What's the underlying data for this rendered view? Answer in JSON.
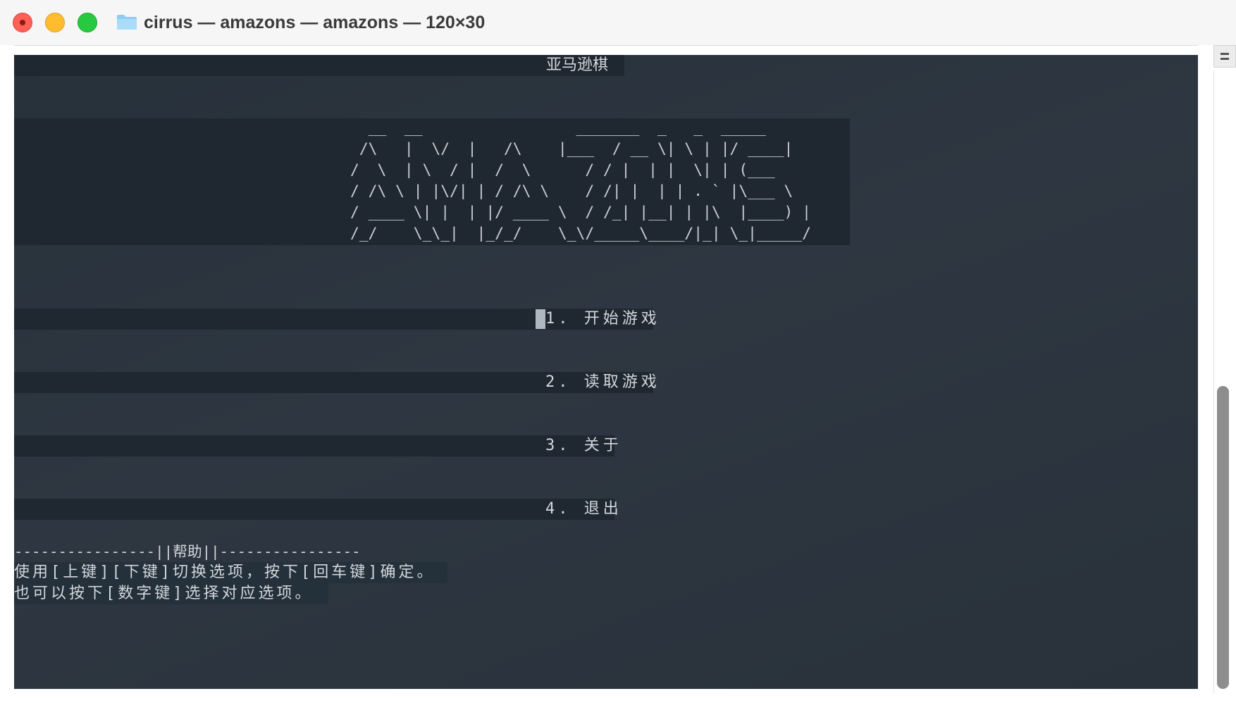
{
  "window": {
    "title": "cirrus — amazons — amazons — 120×30",
    "folder_icon": "folder-icon",
    "controls": [
      "close",
      "minimize",
      "maximize"
    ],
    "colors": {
      "close": "#fe5f57",
      "minimize": "#febc2e",
      "maximize": "#28c840"
    }
  },
  "terminal": {
    "header_title": "亚马逊棋",
    "ascii_logo": "  __  __                 _______  _   _  _____\n /\\   |  \\/  |   /\\    |___  / __ \\| \\ | |/ ____|\n/  \\  | \\  / |  /  \\      / / |  | |  \\| | (___\n/ /\\ \\ | |\\/| | / /\\ \\    / /| |  | | . ` |\\___ \\\n/ ____ \\| |  | |/ ____ \\  / /_| |__| | |\\  |____) |\n/_/    \\_\\_|  |_/_/    \\_\\/_____\\____/|_| \\_|_____/",
    "menu": {
      "cursor": ">",
      "selected_index": 0,
      "items": [
        "1. 开始游戏",
        "2. 读取游戏",
        "3. 关于",
        "4. 退出"
      ]
    },
    "help": {
      "header": "----------------||帮助||----------------",
      "line1": "使用[上键][下键]切换选项，按下[回车键]确定。",
      "line2": "也可以按下[数字键]选择对应选项。"
    },
    "colors": {
      "background": "#2c353f",
      "highlight_band": "#1f2831",
      "text": "#d2d7dc"
    }
  }
}
